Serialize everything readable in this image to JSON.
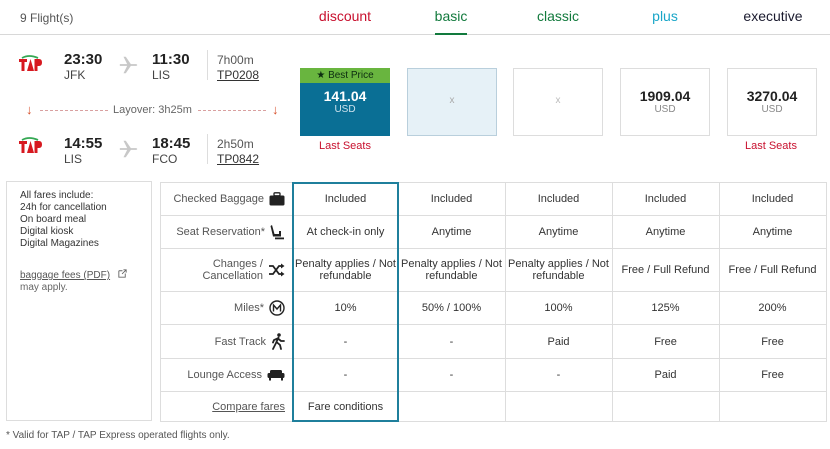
{
  "header": {
    "flight_count": "9 Flight(s)",
    "fares": [
      {
        "label": "discount",
        "color": "#c8102e"
      },
      {
        "label": "basic",
        "color": "#127a3d"
      },
      {
        "label": "classic",
        "color": "#127a3d"
      },
      {
        "label": "plus",
        "color": "#1aa6c8"
      },
      {
        "label": "executive",
        "color": "#1a1a2e"
      }
    ],
    "active_fare": "basic"
  },
  "flights": [
    {
      "dep_time": "23:30",
      "dep_city": "JFK",
      "arr_time": "11:30",
      "arr_city": "LIS",
      "duration": "7h00m",
      "flight_no": "TP0208"
    },
    {
      "dep_time": "14:55",
      "dep_city": "LIS",
      "arr_time": "18:45",
      "arr_city": "FCO",
      "duration": "2h50m",
      "flight_no": "TP0842"
    }
  ],
  "layover": "Layover: 3h25m",
  "prices": [
    {
      "amount": "141.04",
      "currency": "USD",
      "tag": "Best Price",
      "note": "Last Seats",
      "state": "best"
    },
    {
      "amount": "",
      "currency": "",
      "mark": "x",
      "note": "",
      "state": "disabled"
    },
    {
      "amount": "",
      "currency": "",
      "mark": "x",
      "note": "",
      "state": "empty"
    },
    {
      "amount": "1909.04",
      "currency": "USD",
      "note": "",
      "state": "normal"
    },
    {
      "amount": "3270.04",
      "currency": "USD",
      "note": "Last Seats",
      "state": "normal"
    }
  ],
  "info": {
    "all_fares": "All fares include:",
    "items": [
      "24h for cancellation",
      "On board meal",
      "Digital kiosk",
      "Digital Magazines"
    ],
    "baggage_link": "baggage fees (PDF)",
    "may_apply": "may apply."
  },
  "table": {
    "rows": [
      {
        "label": "Checked Baggage",
        "icon": "suitcase-icon",
        "values": [
          "Included",
          "Included",
          "Included",
          "Included",
          "Included"
        ]
      },
      {
        "label": "Seat Reservation*",
        "icon": "seat-icon",
        "values": [
          "At check-in only",
          "Anytime",
          "Anytime",
          "Anytime",
          "Anytime"
        ]
      },
      {
        "label": "Changes / Cancellation",
        "icon": "shuffle-icon",
        "values": [
          "Penalty applies / Not refundable",
          "Penalty applies / Not refundable",
          "Penalty applies / Not refundable",
          "Free / Full Refund",
          "Free / Full Refund"
        ]
      },
      {
        "label": "Miles*",
        "icon": "miles-icon",
        "values": [
          "10%",
          "50% / 100%",
          "100%",
          "125%",
          "200%"
        ]
      },
      {
        "label": "Fast Track",
        "icon": "walker-icon",
        "values": [
          "-",
          "-",
          "Paid",
          "Free",
          "Free"
        ]
      },
      {
        "label": "Lounge Access",
        "icon": "sofa-icon",
        "values": [
          "-",
          "-",
          "-",
          "Paid",
          "Free"
        ]
      },
      {
        "label": "Compare fares",
        "icon": "",
        "values": [
          "Fare conditions",
          "",
          "",
          "",
          ""
        ]
      }
    ]
  },
  "footnote": "* Valid for TAP / TAP Express operated flights only."
}
